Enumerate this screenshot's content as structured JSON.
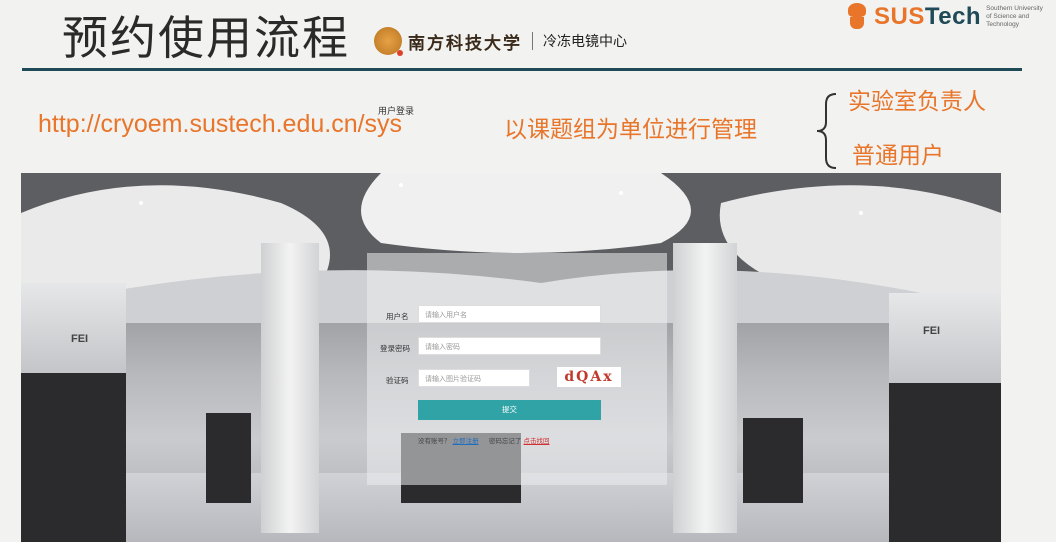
{
  "slide": {
    "title": "预约使用流程",
    "url": "http://cryoem.sustech.edu.cn/sys",
    "management_text": "以课题组为单位进行管理",
    "roles": [
      "实验室负责人",
      "普通用户"
    ]
  },
  "logo": {
    "text_a": "SUS",
    "text_b": "Tech",
    "subtitle": "Southern University of Science and Technology"
  },
  "website": {
    "university_name": "南方科技大学",
    "center_name": "冷冻电镜中心",
    "login": {
      "title": "用户登录",
      "username_label": "用户名",
      "username_placeholder": "请输入用户名",
      "password_label": "登录密码",
      "password_placeholder": "请输入密码",
      "captcha_label": "验证码",
      "captcha_placeholder": "请输入图片验证码",
      "captcha_text": "dQAx",
      "submit_label": "提交",
      "no_account_text": "没有账号？",
      "register_link": "立即注册",
      "forgot_text": "密码忘记了",
      "find_password_link": "点击找回"
    },
    "equipment_brand": "FEI"
  },
  "colors": {
    "accent_orange": "#e8752a",
    "rule_teal": "#1f4a57",
    "submit_teal": "#2fa3a6"
  }
}
